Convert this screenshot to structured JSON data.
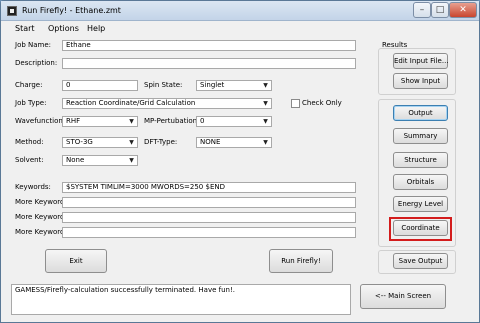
{
  "window": {
    "title": "Run Firefly! - Ethane.zmt"
  },
  "titlebar_buttons": {
    "minimize": "–",
    "maximize": "□",
    "close": "✕"
  },
  "menu": [
    "Start",
    "Options",
    "Help"
  ],
  "form": {
    "job_name": {
      "label": "Job Name:",
      "value": "Ethane"
    },
    "description": {
      "label": "Description:",
      "value": ""
    },
    "charge": {
      "label": "Charge:",
      "value": "0"
    },
    "spin_state": {
      "label": "Spin State:",
      "value": "Singlet"
    },
    "job_type": {
      "label": "Job Type:",
      "value": "Reaction Coordinate/Grid Calculation"
    },
    "check_only": {
      "label": "Check Only",
      "checked": false
    },
    "wavefunction": {
      "label": "Wavefunction:",
      "value": "RHF"
    },
    "mp_perturbation": {
      "label": "MP-Pertubation:",
      "value": "0"
    },
    "method": {
      "label": "Method:",
      "value": "STO-3G"
    },
    "dft_type": {
      "label": "DFT-Type:",
      "value": "NONE"
    },
    "solvent": {
      "label": "Solvent:",
      "value": "None"
    },
    "keywords": {
      "label": "Keywords:",
      "value": "$SYSTEM TIMLIM=3000 MWORDS=250 $END"
    },
    "more_keywords": [
      {
        "label": "More Keywords",
        "value": ""
      },
      {
        "label": "More Keywords",
        "value": ""
      },
      {
        "label": "More Keywords",
        "value": ""
      }
    ]
  },
  "buttons": {
    "exit": "Exit",
    "run": "Run Firefly!",
    "main_screen": "<-- Main Screen"
  },
  "results": {
    "title": "Results",
    "edit_input": "Edit Input File...",
    "show_input": "Show Input",
    "output": "Output",
    "summary": "Summary",
    "structure": "Structure",
    "orbitals": "Orbitals",
    "energy_level": "Energy Level",
    "coordinate": "Coordinate",
    "save_output": "Save Output"
  },
  "status": {
    "message": "GAMESS/Firefly-calculation successfully terminated. Have fun!."
  },
  "colors": {
    "highlight": "#d31c1c",
    "focus_border": "#3c7fb1"
  }
}
